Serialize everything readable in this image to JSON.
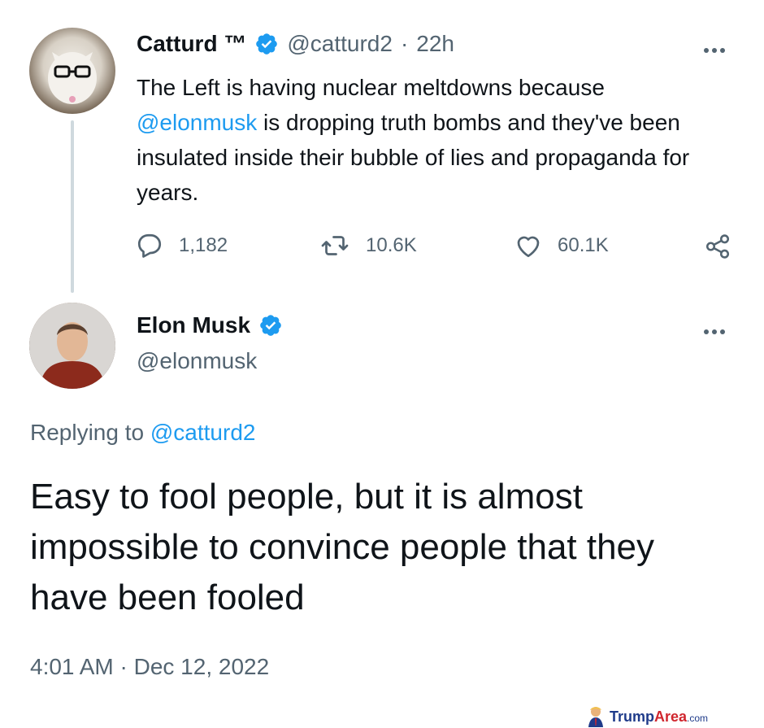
{
  "tweet1": {
    "display_name": "Catturd ™",
    "handle": "@catturd2",
    "separator": "·",
    "time_ago": "22h",
    "text_before": "The Left is having nuclear meltdowns because ",
    "mention": "@elonmusk",
    "text_after": " is dropping truth bombs and they've been insulated inside their bubble of lies and propaganda for years.",
    "replies": "1,182",
    "retweets": "10.6K",
    "likes": "60.1K"
  },
  "tweet2": {
    "display_name": "Elon Musk",
    "handle": "@elonmusk",
    "replying_label": "Replying to",
    "replying_to": "@catturd2",
    "text": "Easy to fool people, but it is almost impossible to convince people that they have been fooled",
    "timestamp": "4:01 AM · Dec 12, 2022"
  },
  "watermark": {
    "brand_part1": "Trump",
    "brand_part2": "Area",
    "domain_suffix": ".com"
  },
  "colors": {
    "link": "#1d9bf0",
    "secondary_text": "#536471",
    "verified_badge": "#1d9bf0",
    "thread_line": "#cfd9de"
  },
  "icons": {
    "verified": "verified-badge-icon",
    "more": "more-options-icon",
    "reply": "reply-icon",
    "retweet": "retweet-icon",
    "like": "heart-icon",
    "share": "share-icon"
  }
}
